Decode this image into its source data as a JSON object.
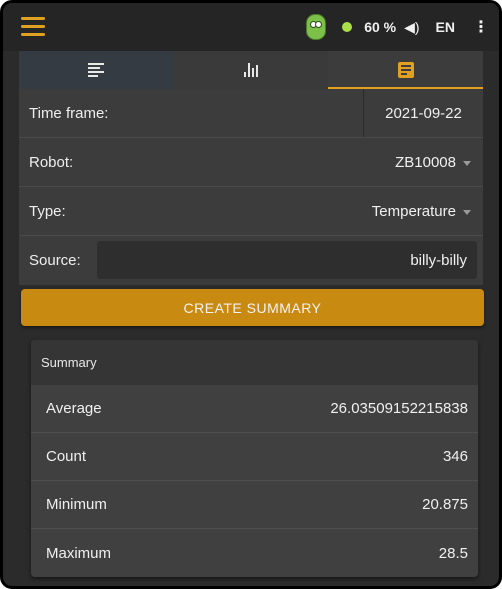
{
  "header": {
    "battery": "60 %",
    "speaker_icon": "speaker-icon",
    "language": "EN",
    "more_icon": "⋮"
  },
  "tabs": [
    {
      "name": "list",
      "icon": "list-icon",
      "active": false
    },
    {
      "name": "chart",
      "icon": "bar-chart-icon",
      "active": false
    },
    {
      "name": "summary",
      "icon": "document-icon",
      "active": true
    }
  ],
  "form": {
    "time_frame_label": "Time frame:",
    "time_frame_value": "2021-09-22",
    "robot_label": "Robot:",
    "robot_value": "ZB10008",
    "type_label": "Type:",
    "type_value": "Temperature",
    "source_label": "Source:",
    "source_value": "billy-billy"
  },
  "create_button_label": "CREATE SUMMARY",
  "summary": {
    "title": "Summary",
    "rows": [
      {
        "label": "Average",
        "value": "26.03509152215838"
      },
      {
        "label": "Count",
        "value": "346"
      },
      {
        "label": "Minimum",
        "value": "20.875"
      },
      {
        "label": "Maximum",
        "value": "28.5"
      }
    ]
  },
  "colors": {
    "accent": "#e0a020",
    "button": "#c98a12",
    "status": "#a9e04a"
  }
}
